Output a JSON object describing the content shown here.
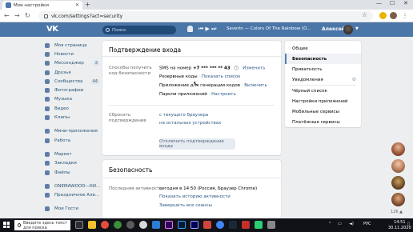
{
  "browser": {
    "tab_title": "Мои настройки",
    "new_tab": "+",
    "url": "vk.com/settings?act=security",
    "win_min": "—",
    "win_max": "☐",
    "win_close": "✕"
  },
  "header": {
    "logo": "VK",
    "search_placeholder": "Поиск",
    "track": "Severin — Colors Of The Rainbow (O...",
    "username": "Алексей"
  },
  "sidebar": {
    "items": [
      {
        "label": "Моя страница",
        "badge": ""
      },
      {
        "label": "Новости",
        "badge": ""
      },
      {
        "label": "Мессенджер",
        "badge": "2"
      },
      {
        "label": "Друзья",
        "badge": ""
      },
      {
        "label": "Сообщества",
        "badge": "44"
      },
      {
        "label": "Фотографии",
        "badge": ""
      },
      {
        "label": "Музыка",
        "badge": ""
      },
      {
        "label": "Видео",
        "badge": ""
      },
      {
        "label": "Клипы",
        "badge": ""
      }
    ],
    "items2": [
      {
        "label": "Мини-приложения"
      },
      {
        "label": "Работа"
      }
    ],
    "items3": [
      {
        "label": "Маркет"
      },
      {
        "label": "Закладки"
      },
      {
        "label": "Файлы"
      }
    ],
    "items4": [
      {
        "label": "ONEMAWOOD—КИ..."
      },
      {
        "label": "Праздничное Але..."
      }
    ],
    "items5": [
      {
        "label": "Мои Гости"
      }
    ]
  },
  "login": {
    "title": "Подтверждение входа",
    "methods_label": "Способы получить код безопасности",
    "sms_text": "SMS на номер",
    "phone": "+7 *** *** ** 43",
    "qmark": "?",
    "change": "Изменить",
    "backup_codes": "Резервные коды",
    "show_list": "Показать список",
    "app_text": "Приложение для генерации кодов",
    "enable": "Включить",
    "app_passwords": "Пароли приложений",
    "configure": "Настроить",
    "reset_label": "Сбросить подтверждение",
    "reset_current": "с текущего браузера",
    "reset_others": "на остальных устройствах",
    "disable_button": "Отключить подтверждение входа"
  },
  "security": {
    "title": "Безопасность",
    "last_activity_label": "Последняя активность",
    "last_activity_value": "сегодня в 14:50 (Россия, Браузер Chrome)",
    "show_history": "Показать историю активности",
    "end_sessions": "Завершить все сеансы"
  },
  "settings_menu": {
    "items": [
      {
        "label": "Общее",
        "active": false
      },
      {
        "label": "Безопасность",
        "active": true
      },
      {
        "label": "Приватность",
        "active": false
      },
      {
        "label": "Уведомления",
        "active": false
      },
      {
        "label": "Чёрный список",
        "active": false
      },
      {
        "label": "Настройки приложений",
        "active": false
      },
      {
        "label": "Мобильные сервисы",
        "active": false
      },
      {
        "label": "Платёжные сервисы",
        "active": false
      }
    ]
  },
  "right_bubbles": {
    "count": "126 ▲"
  },
  "taskbar": {
    "search_placeholder": "Введите здесь текст для поиска",
    "lang": "РУС",
    "time": "14:51",
    "date": "30.11.2020"
  },
  "colors": {
    "vk_blue": "#4a76a8",
    "link": "#2a5885",
    "background": "#edeef0",
    "taskbar": "#101218"
  }
}
